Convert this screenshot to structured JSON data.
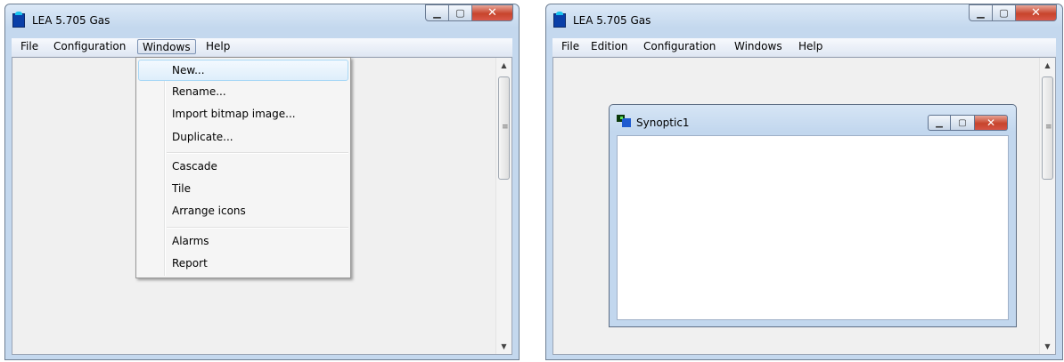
{
  "left_window": {
    "title": "LEA 5.705 Gas",
    "caption": {
      "minimize": "▁",
      "maximize": "▢",
      "close": "✕"
    },
    "menu": {
      "file": "File",
      "configuration": "Configuration",
      "windows": "Windows",
      "help": "Help"
    },
    "windows_menu": {
      "new": "New...",
      "rename": "Rename...",
      "import_bitmap": "Import bitmap image...",
      "duplicate": "Duplicate...",
      "cascade": "Cascade",
      "tile": "Tile",
      "arrange_icons": "Arrange icons",
      "alarms": "Alarms",
      "report": "Report"
    },
    "scrollbar": {
      "up": "▲",
      "down": "▼",
      "grip": "≡"
    }
  },
  "right_window": {
    "title": "LEA 5.705 Gas",
    "caption": {
      "minimize": "▁",
      "maximize": "▢",
      "close": "✕"
    },
    "menu": {
      "file": "File",
      "edition": "Edition",
      "configuration": "Configuration",
      "windows": "Windows",
      "help": "Help"
    },
    "scrollbar": {
      "up": "▲",
      "down": "▼",
      "grip": "≡"
    },
    "child_window": {
      "title": "Synoptic1",
      "caption": {
        "minimize": "▁",
        "maximize": "▢",
        "close": "✕"
      }
    }
  }
}
